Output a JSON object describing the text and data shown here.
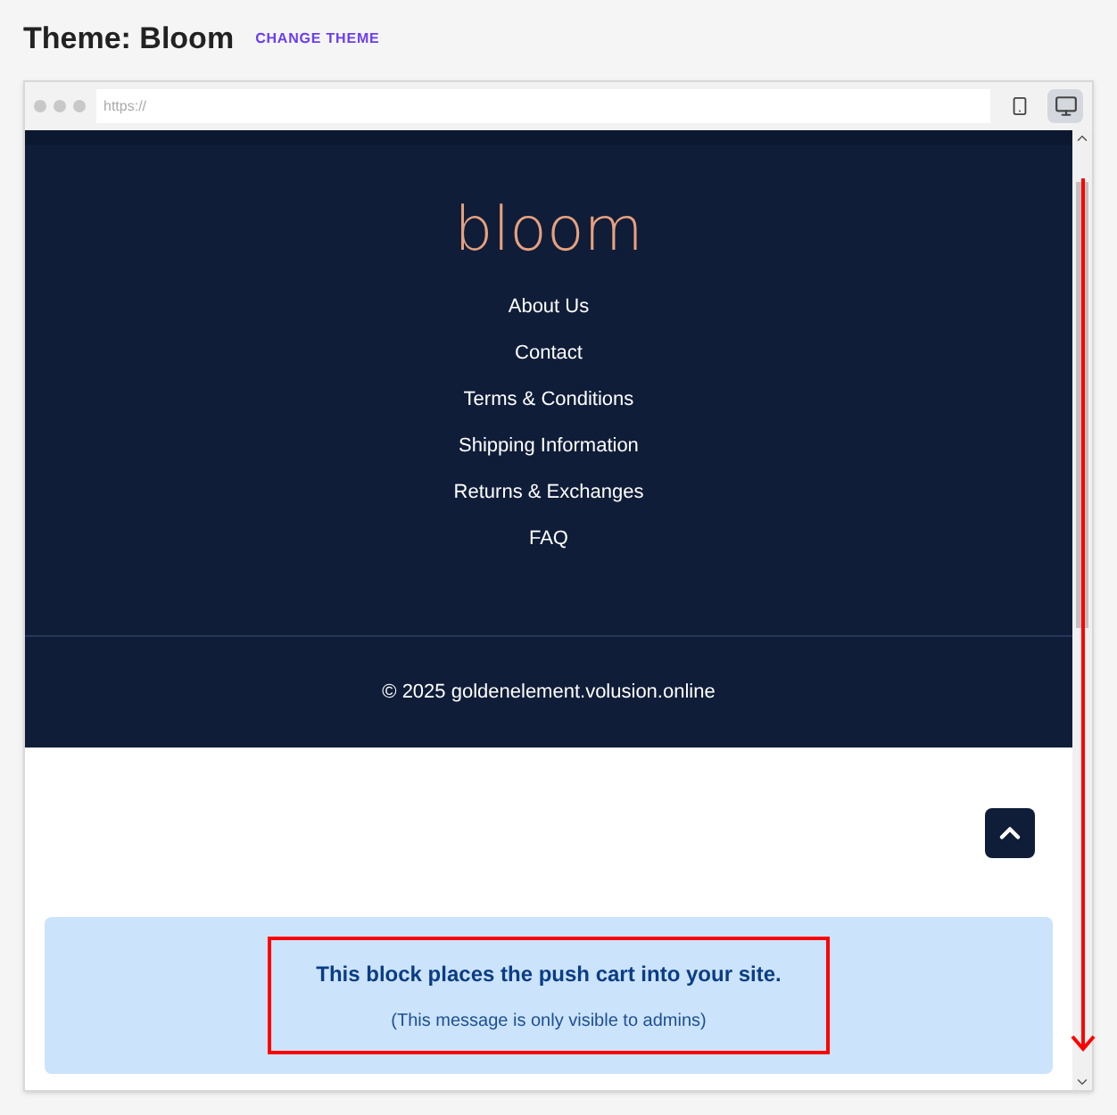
{
  "header": {
    "title": "Theme: Bloom",
    "action": "CHANGE THEME"
  },
  "browser": {
    "address_placeholder": "https://",
    "devices": [
      {
        "kind": "mobile",
        "selected": false
      },
      {
        "kind": "desktop",
        "selected": true
      }
    ]
  },
  "footer": {
    "logo": "bloom",
    "links": [
      "About Us",
      "Contact",
      "Terms & Conditions",
      "Shipping Information",
      "Returns & Exchanges",
      "FAQ"
    ],
    "copyright": "© 2025 goldenelement.volusion.online"
  },
  "notice": {
    "title": "This block places the push cart into your site.",
    "subtitle": "(This message is only visible to admins)"
  }
}
